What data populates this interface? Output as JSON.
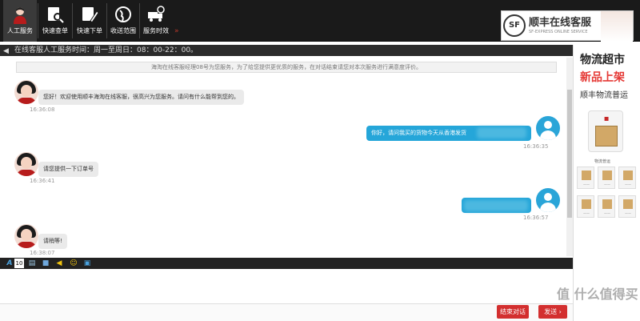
{
  "nav": {
    "items": [
      {
        "label": "人工服务",
        "icon": "agent-icon"
      },
      {
        "label": "快速查单",
        "icon": "search-order-icon"
      },
      {
        "label": "快速下单",
        "icon": "quick-order-icon"
      },
      {
        "label": "收送范围",
        "icon": "globe-icon"
      },
      {
        "label": "服务时效",
        "icon": "truck-clock-icon"
      }
    ],
    "more": "»"
  },
  "brand": {
    "logo": "SF",
    "title": "顺丰在线客服",
    "subtitle": "SF-EXPRESS ONLINE SERVICE"
  },
  "notice": "在线客服人工服务时间：周一至周日：08：00-22：00。",
  "system_message": "海淘在线客服经理08号为您服务，为了给您提供更优质的服务，在对话结束请您对本次服务进行满意度评价。",
  "messages": [
    {
      "side": "left",
      "text": "您好！欢迎使用顺丰海淘在线客服，很高兴为您服务。请问有什么能帮到您的。",
      "time": "16:36:08"
    },
    {
      "side": "right",
      "text": "你好，请问我买的货物今天从香港发货",
      "time": "16:36:35"
    },
    {
      "side": "left",
      "text": "请您提供一下订单号",
      "time": "16:36:41"
    },
    {
      "side": "right",
      "text": "",
      "time": "16:36:57"
    },
    {
      "side": "left",
      "text": "请稍等!",
      "time": "16:38:07"
    }
  ],
  "toolbar": {
    "font_icon": "A",
    "font_size": "10"
  },
  "buttons": {
    "end": "结束对话",
    "send": "发送"
  },
  "ad": {
    "line1": "物流超市",
    "line2": "新品上架",
    "line3": "顺丰物流普运",
    "caption": "物流普运"
  },
  "watermark": "值 什么值得买",
  "colors": {
    "bubble_user": "#25a6d9",
    "accent": "#d32f2f",
    "topbar": "#1a1a1a"
  }
}
